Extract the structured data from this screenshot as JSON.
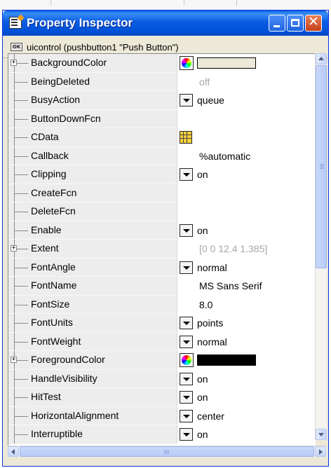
{
  "window": {
    "title": "Property Inspector",
    "close_glyph": "✕"
  },
  "object": {
    "icon_text": "OK",
    "label": "uicontrol (pushbutton1 \"Push Button\")"
  },
  "properties": [
    {
      "name": "BackgroundColor",
      "expandable": true,
      "control": "color",
      "color": "#ece9d8",
      "value": ""
    },
    {
      "name": "BeingDeleted",
      "control": "none",
      "value": "off",
      "dim": true
    },
    {
      "name": "BusyAction",
      "control": "dropdown",
      "value": "queue"
    },
    {
      "name": "ButtonDownFcn",
      "control": "none",
      "value": ""
    },
    {
      "name": "CData",
      "control": "grid",
      "value": ""
    },
    {
      "name": "Callback",
      "control": "none",
      "value": "%automatic"
    },
    {
      "name": "Clipping",
      "control": "dropdown",
      "value": "on"
    },
    {
      "name": "CreateFcn",
      "control": "none",
      "value": ""
    },
    {
      "name": "DeleteFcn",
      "control": "none",
      "value": ""
    },
    {
      "name": "Enable",
      "control": "dropdown",
      "value": "on"
    },
    {
      "name": "Extent",
      "expandable": true,
      "control": "none",
      "value": "[0 0 12.4 1.385]",
      "dim": true
    },
    {
      "name": "FontAngle",
      "control": "dropdown",
      "value": "normal"
    },
    {
      "name": "FontName",
      "control": "none",
      "value": "MS Sans Serif"
    },
    {
      "name": "FontSize",
      "control": "none",
      "value": "8.0"
    },
    {
      "name": "FontUnits",
      "control": "dropdown",
      "value": "points"
    },
    {
      "name": "FontWeight",
      "control": "dropdown",
      "value": "normal"
    },
    {
      "name": "ForegroundColor",
      "expandable": true,
      "control": "color",
      "color": "#000000",
      "value": ""
    },
    {
      "name": "HandleVisibility",
      "control": "dropdown",
      "value": "on"
    },
    {
      "name": "HitTest",
      "control": "dropdown",
      "value": "on"
    },
    {
      "name": "HorizontalAlignment",
      "control": "dropdown",
      "value": "center"
    },
    {
      "name": "Interruptible",
      "control": "dropdown",
      "value": "on"
    }
  ],
  "icons": {
    "app": "property-editor-icon",
    "minimize": "minimize-icon",
    "maximize": "maximize-icon",
    "close": "close-icon",
    "object": "pushbutton-icon",
    "expander": "plus-expander-icon",
    "dropdown": "dropdown-arrow-icon",
    "color": "color-wheel-icon",
    "cdata": "grid-matrix-icon"
  },
  "colors": {
    "title_bar": "#0a5ce3",
    "name_column": "#ededed",
    "dim_text": "#a8a8a8"
  }
}
